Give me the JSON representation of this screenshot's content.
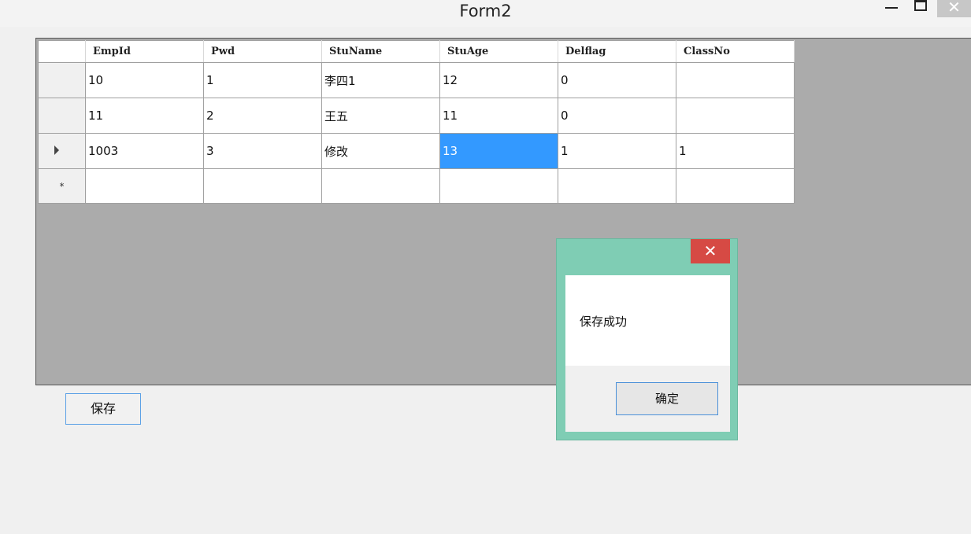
{
  "window": {
    "title": "Form2",
    "min_glyph": "",
    "close_glyph": "✕"
  },
  "grid": {
    "columns": [
      "EmpId",
      "Pwd",
      "StuName",
      "StuAge",
      "Delflag",
      "ClassNo"
    ],
    "rows": [
      [
        "10",
        "1",
        "李四1",
        "12",
        "0",
        ""
      ],
      [
        "11",
        "2",
        "王五",
        "11",
        "0",
        ""
      ],
      [
        "1003",
        "3",
        "修改",
        "13",
        "1",
        "1"
      ]
    ],
    "new_row_marker": "*",
    "selected_cell": {
      "row": 3,
      "column": "StuAge"
    }
  },
  "save_button": {
    "label": "保存"
  },
  "message_box": {
    "text": "保存成功",
    "ok_label": "确定",
    "close_glyph": "✕"
  }
}
